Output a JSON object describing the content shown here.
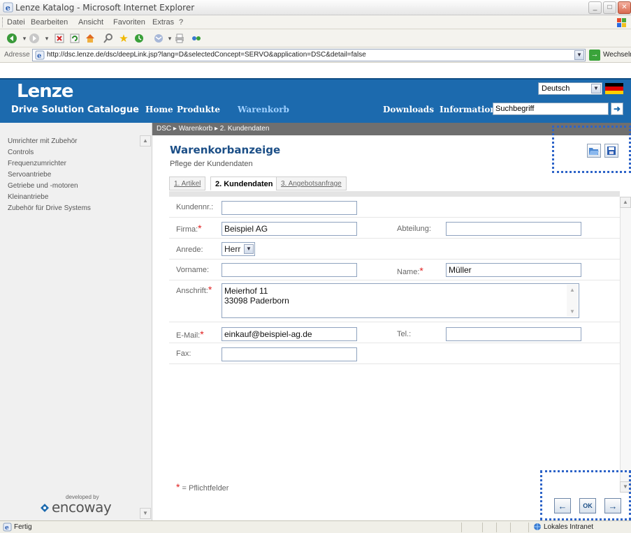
{
  "window": {
    "title": "Lenze Katalog - Microsoft Internet Explorer"
  },
  "menubar": {
    "items": [
      "Datei",
      "Bearbeiten",
      "Ansicht",
      "Favoriten",
      "Extras",
      "?"
    ]
  },
  "addressbar": {
    "label": "Adresse",
    "url": "http://dsc.lenze.de/dsc/deepLink.jsp?lang=D&selectedConcept=SERVO&application=DSC&detail=false",
    "go_label": "Wechseln zu"
  },
  "header": {
    "logo": "Lenze",
    "subtitle": "Drive Solution Catalogue",
    "language": "Deutsch",
    "nav": [
      "Home",
      "Produkte",
      "Warenkorb",
      "Downloads",
      "Information"
    ],
    "active_nav": "Warenkorb",
    "search_value": "Suchbegriff",
    "colors": {
      "brand": "#1c6aae",
      "nav_active": "#9fd0ff"
    }
  },
  "sidebar": {
    "items": [
      "Umrichter mit Zubehör",
      "Controls",
      "Frequenzumrichter",
      "Servoantriebe",
      "Getriebe und -motoren",
      "Kleinantriebe",
      "Zubehör für Drive Systems"
    ],
    "footer_developed": "developed by",
    "footer_brand": "encoway"
  },
  "breadcrumb": {
    "text": "DSC ▸ Warenkorb ▸ 2. Kundendaten"
  },
  "main": {
    "title": "Warenkorbanzeige",
    "subtitle": "Pflege der Kundendaten",
    "tabs": [
      {
        "label": "1. Artikel",
        "active": false
      },
      {
        "label": "2. Kundendaten",
        "active": true
      },
      {
        "label": "3. Angebotsanfrage",
        "active": false
      }
    ],
    "icons": {
      "open": "open-folder-icon",
      "save": "save-disk-icon"
    },
    "form": {
      "kundennr": {
        "label": "Kundennr.:",
        "value": ""
      },
      "firma": {
        "label": "Firma:",
        "value": "Beispiel AG",
        "required": true
      },
      "abteilung": {
        "label": "Abteilung:",
        "value": ""
      },
      "anrede": {
        "label": "Anrede:",
        "value": "Herr"
      },
      "vorname": {
        "label": "Vorname:",
        "value": ""
      },
      "name": {
        "label": "Name:",
        "value": "Müller",
        "required": true
      },
      "anschrift": {
        "label": "Anschrift:",
        "line1": "Meierhof 11",
        "line2": "33098 Paderborn",
        "required": true
      },
      "email": {
        "label": "E-Mail:",
        "value": "einkauf@beispiel-ag.de",
        "required": true
      },
      "tel": {
        "label": "Tel.:",
        "value": ""
      },
      "fax": {
        "label": "Fax:",
        "value": ""
      }
    },
    "required_marker": "*",
    "legend_text": "= Pflichtfelder",
    "buttons": {
      "back": "←",
      "ok": "OK",
      "next": "→"
    }
  },
  "statusbar": {
    "text": "Fertig",
    "zone": "Lokales Intranet"
  }
}
